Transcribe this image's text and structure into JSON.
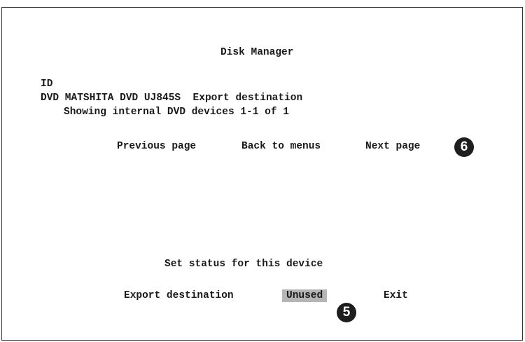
{
  "screen": {
    "title": "Disk Manager",
    "id_header": "ID",
    "device_line": "DVD MATSHITA DVD UJ845S  Export destination",
    "showing_text": "Showing internal DVD devices 1-1 of 1"
  },
  "nav": {
    "previous": "Previous page",
    "back": "Back to menus",
    "next": "Next page"
  },
  "status": {
    "prompt": "Set status for this device",
    "export_destination": "Export destination",
    "unused": "Unused",
    "exit": "Exit"
  },
  "callouts": {
    "six": "6",
    "five": "5"
  },
  "colors": {
    "highlight": "#b5b5b5",
    "callout_bg": "#1e1e1e"
  }
}
